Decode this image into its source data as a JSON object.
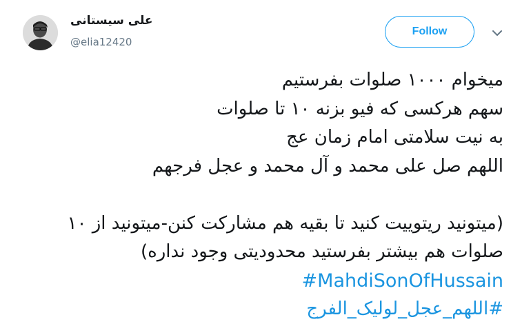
{
  "user": {
    "name": "علی سیستانی",
    "handle": "@elia12420"
  },
  "actions": {
    "follow_label": "Follow",
    "menu_icon": "chevron-down-icon"
  },
  "tweet": {
    "paragraph1": [
      "میخوام ۱۰۰۰ صلوات بفرستیم",
      "سهم هرکسی که فیو بزنه ۱۰ تا صلوات",
      "به نیت سلامتی امام زمان عج",
      "اللهم صل علی محمد و آل محمد و عجل فرجهم"
    ],
    "paragraph2": [
      "(میتونید ریتوییت کنید تا بقیه هم مشارکت کنن-میتونید از ۱۰",
      "صلوات هم بیشتر بفرستید محدودیتی وجود نداره)"
    ],
    "hashtags": [
      "#MahdiSonOfHussain",
      "#اللهم_عجل_لولیک_الفرج"
    ]
  },
  "colors": {
    "accent": "#1da1f2",
    "hashtag": "#1b95e0",
    "text": "#14171a",
    "secondary": "#657786"
  }
}
